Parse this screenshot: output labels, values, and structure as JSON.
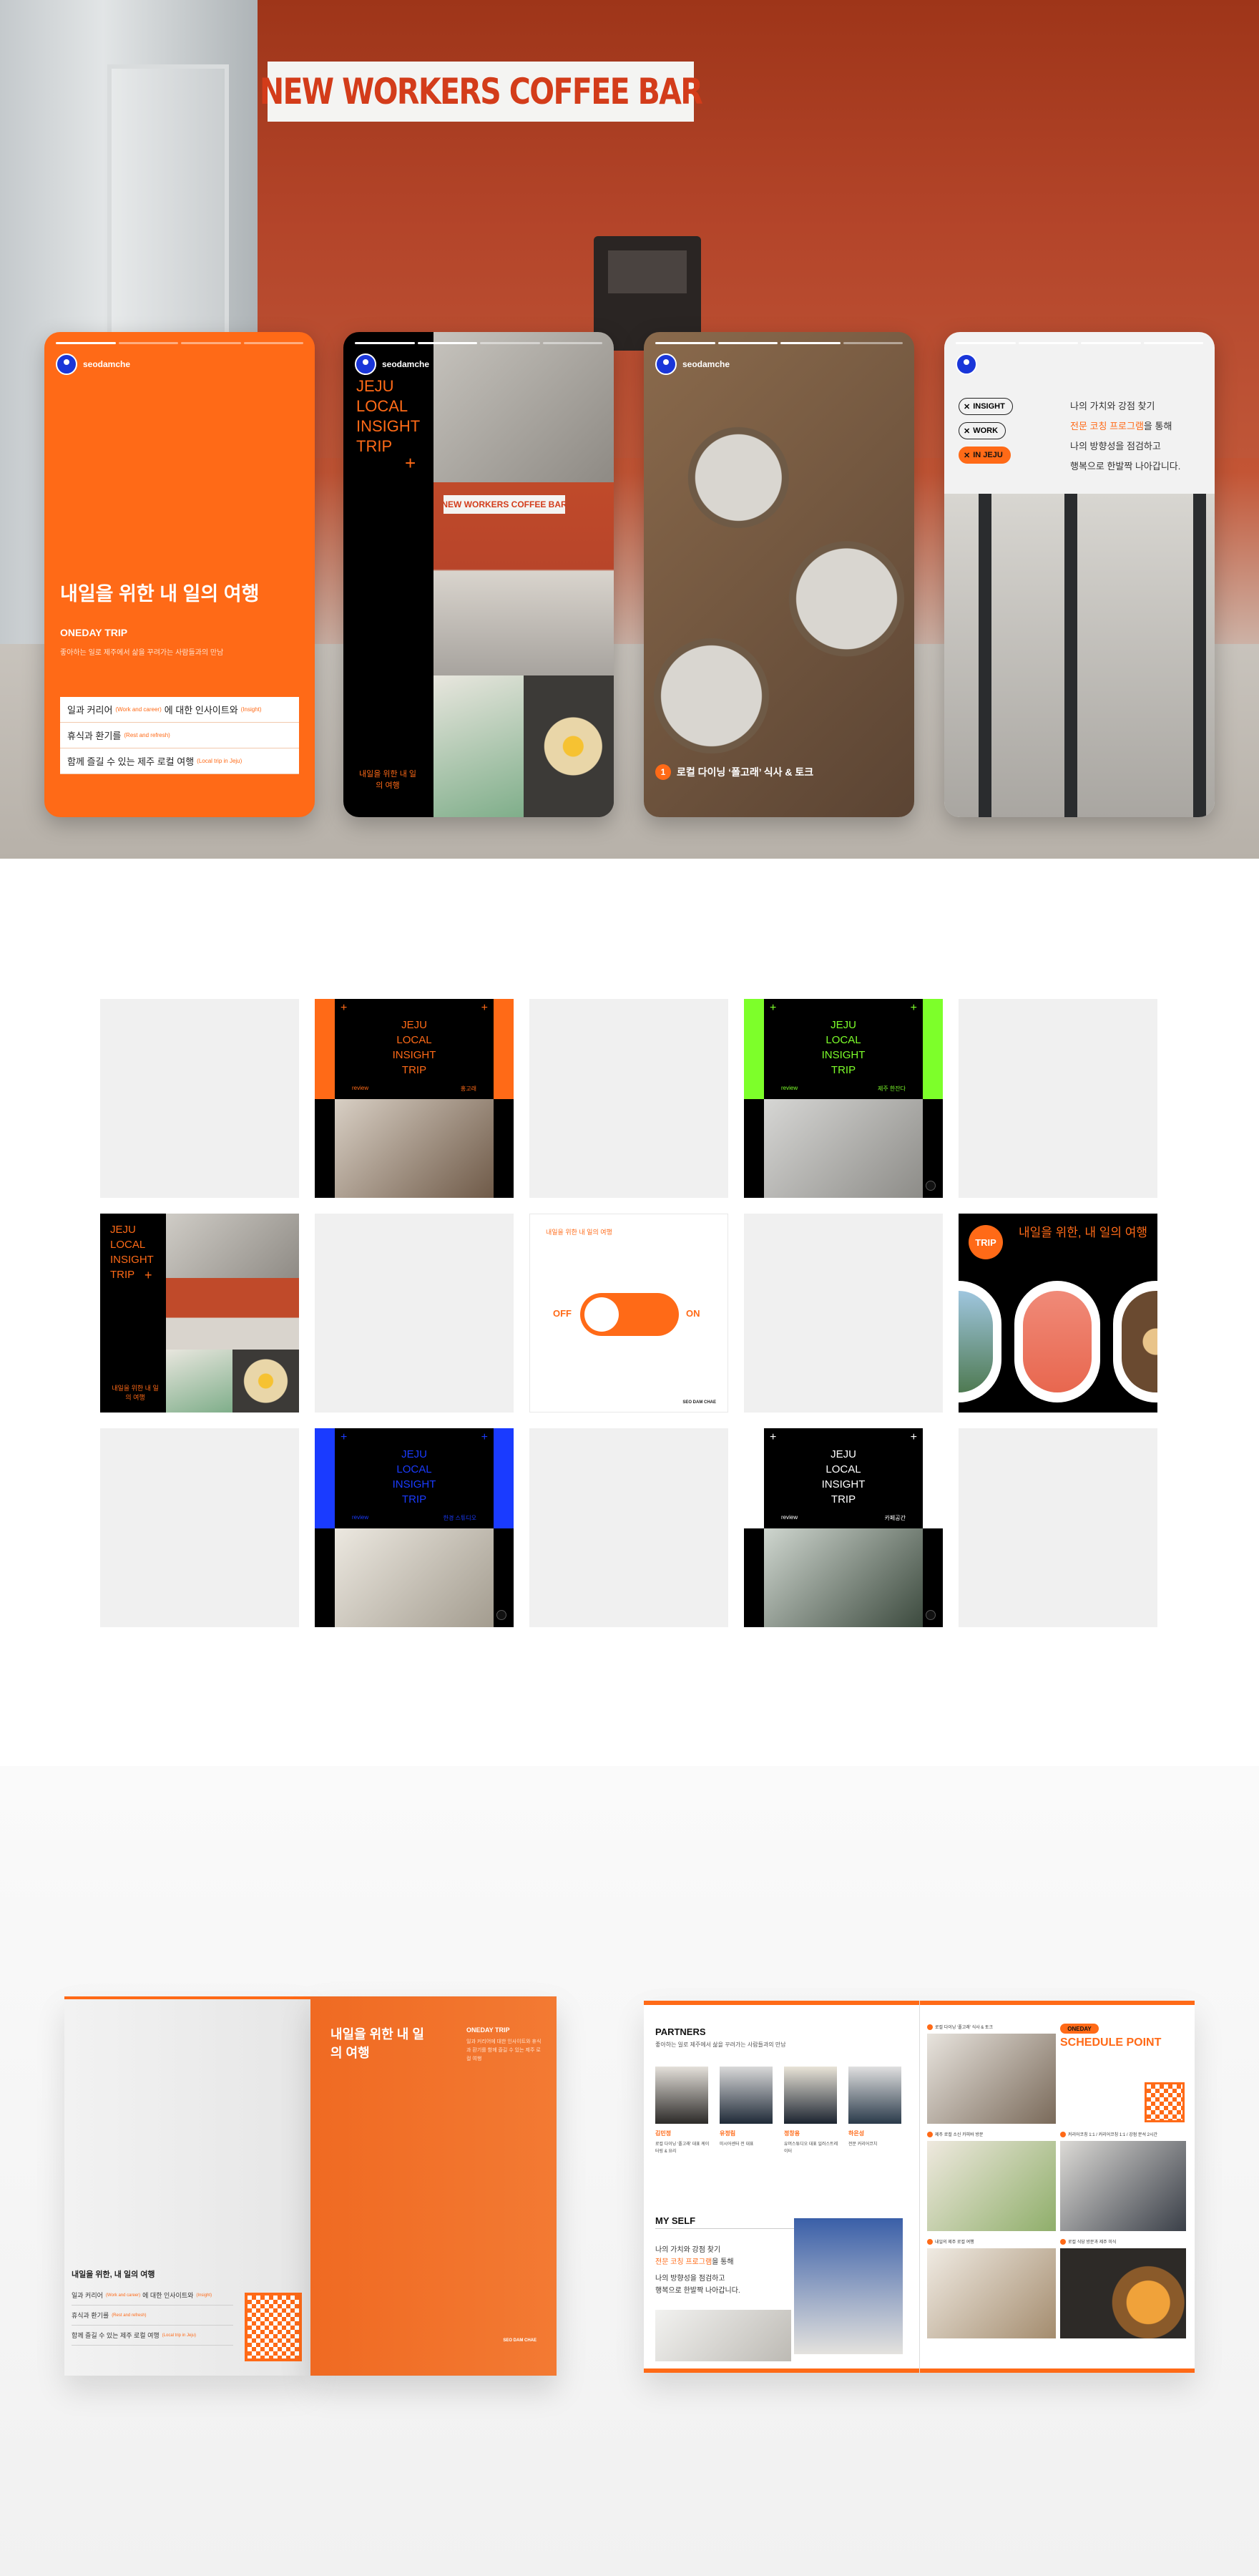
{
  "hero": {
    "sign": "NEW WORKERS COFFEE BAR",
    "stories": {
      "username": "seodamche",
      "s1": {
        "title": "내일을 위한 내 일의 여행",
        "subtitle": "ONEDAY TRIP",
        "desc": "좋아하는 일로 제주에서 삶을 꾸려가는 사람들과의 만남",
        "items": [
          {
            "label": "일과 커리어",
            "en": "(Work and career)",
            "label2": "에 대한 인사이트와",
            "en2": "(Insight)"
          },
          {
            "label": "휴식과 환기를",
            "en": "(Rest and refresh)",
            "label2": "",
            "en2": ""
          },
          {
            "label": "함께 즐길 수 있는 제주 로컬 여행",
            "en": "(Local trip in Jeju)",
            "label2": "",
            "en2": ""
          }
        ]
      },
      "s2": {
        "title_lines": [
          "JEJU",
          "LOCAL",
          "INSIGHT",
          "TRIP"
        ],
        "plus": "+",
        "mini_sign": "NEW WORKERS COFFEE BAR",
        "footer": "내일을 위한 내 일의 여행"
      },
      "s3": {
        "num": "1",
        "caption": "로컬 다이닝 ‘폴고래’ 식사 & 토크"
      },
      "s4": {
        "tags": [
          "INSIGHT",
          "WORK",
          "IN JEJU"
        ],
        "lines": [
          "나의 가치와 강점 찾기",
          "전문 코칭 프로그램",
          "을 통해",
          "나의 방향성을 점검하고",
          "행복으로 한발짝 나아갑니다."
        ]
      }
    }
  },
  "grid": {
    "jeju_lines": [
      "JEJU",
      "LOCAL",
      "INSIGHT",
      "TRIP"
    ],
    "plus": "+",
    "review": "review",
    "posts": [
      {
        "name": "홍고래",
        "accent": "#ff6a17",
        "text_color": "#ff6a17"
      },
      {
        "name": "제주 한잔다",
        "accent": "#7dff2a",
        "text_color": "#7dff2a"
      },
      {
        "name": "한경 스튜디오",
        "accent": "#1a3bff",
        "text_color": "#1a3bff"
      },
      {
        "name": "카페공간",
        "accent": "#ffffff",
        "text_color": "#ffffff"
      }
    ],
    "tile_jeju_footer": "내일을 위한 내 일의 여행",
    "toggle": {
      "title": "내일을 위한 내 일의 여행",
      "off": "OFF",
      "on": "ON",
      "brand": "SEO DAM CHAE"
    },
    "trip": {
      "badge": "TRIP",
      "title": "내일을 위한, 내 일의 여행"
    }
  },
  "brochure_left": {
    "front_title": "내일을 위한 내 일의 여행",
    "front_sub": "ONEDAY TRIP",
    "front_desc": "일과 커리어에 대한 인사이트와 휴식과 환기를 함께 즐길 수 있는 제주 로컬 여행",
    "brand": "SEO DAM CHAE",
    "back_title": "내일을 위한, 내 일의 여행",
    "back_items": [
      {
        "label": "일과 커리어",
        "en": "(Work and career)",
        "label2": "에 대한 인사이트와",
        "en2": "(Insight)"
      },
      {
        "label": "휴식과 환기를",
        "en": "(Rest and refresh)",
        "label2": "",
        "en2": ""
      },
      {
        "label": "함께 즐길 수 있는 제주 로컬 여행",
        "en": "(Local trip in Jeju)",
        "label2": "",
        "en2": ""
      }
    ]
  },
  "brochure_right": {
    "partners_title": "PARTNERS",
    "partners_sub": "좋아하는 일로 제주에서 삶을 꾸려가는 사람들과의 만남",
    "partners": [
      {
        "name": "김민정",
        "desc": "로컬 다이닝 ‘폴고래’ 대표 케이터링 & 요리"
      },
      {
        "name": "유정림",
        "desc": "미시어센터 전 대표"
      },
      {
        "name": "정창용",
        "desc": "유머스튜디오 대표 일러스트레이터"
      },
      {
        "name": "하은성",
        "desc": "전문 커리어코치"
      }
    ],
    "myself_title": "MY SELF",
    "myself_lines": [
      "나의 가치와 강점 찾기",
      "전문 코칭 프로그램",
      "을 통해",
      "나의 방향성을 점검하고",
      "행복으로 한발짝 나아갑니다."
    ],
    "schedule_badge": "ONEDAY",
    "schedule_title": "SCHEDULE POINT",
    "captions": [
      "로컬 다이닝 ‘폴고래’ 식사 & 토크",
      "제주 로컬 소신 카피바 방문",
      "커리어코칭 1:1 / 커리어코칭 1:1 / 강점 분석 2시간",
      "내일의 제주 로컬 여행",
      "로컬 식당 방문과 제주 미식"
    ]
  }
}
